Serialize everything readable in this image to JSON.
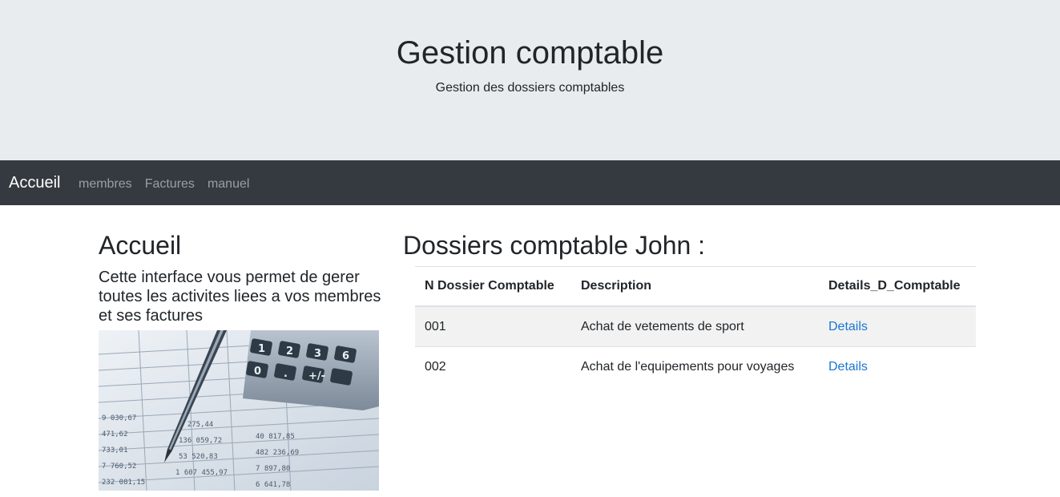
{
  "header": {
    "title": "Gestion comptable",
    "subtitle": "Gestion des dossiers comptables"
  },
  "navbar": {
    "brand": "Accueil",
    "links": [
      "membres",
      "Factures",
      "manuel"
    ],
    "background": "#343a40"
  },
  "sidebar": {
    "title": "Accueil",
    "text": "Cette interface vous permet de gerer toutes les activites liees a vos membres et ses factures",
    "image_icon": "calculator-pen-accounting-image"
  },
  "main": {
    "title": "Dossiers comptable John :",
    "table": {
      "headers": [
        "N Dossier Comptable",
        "Description",
        "Details_D_Comptable"
      ],
      "rows": [
        {
          "num": "001",
          "description": "Achat de vetements de sport",
          "link": "Details"
        },
        {
          "num": "002",
          "description": "Achat de l'equipements pour voyages",
          "link": "Details"
        }
      ]
    }
  },
  "colors": {
    "jumbotron_bg": "#e9ecef",
    "link": "#1976d2"
  }
}
